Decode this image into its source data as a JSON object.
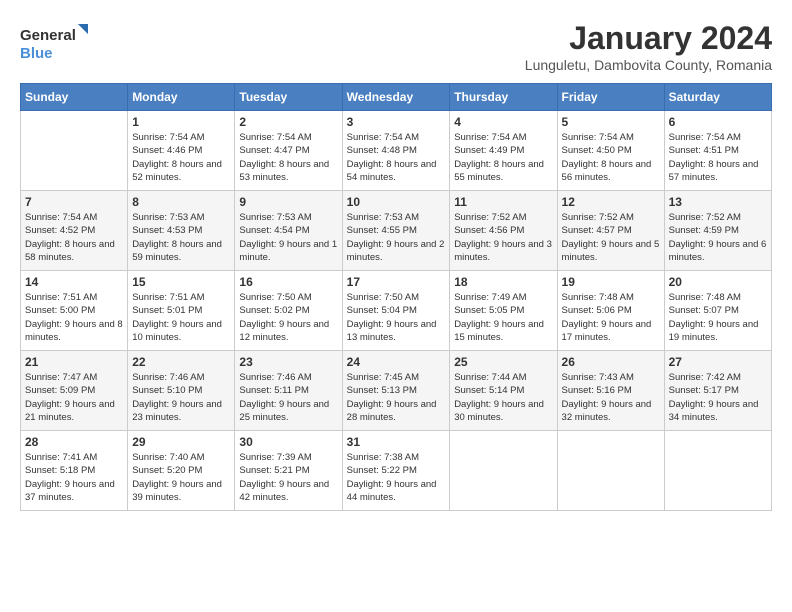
{
  "logo": {
    "line1": "General",
    "line2": "Blue"
  },
  "header": {
    "month_year": "January 2024",
    "location": "Lunguletu, Dambovita County, Romania"
  },
  "weekdays": [
    "Sunday",
    "Monday",
    "Tuesday",
    "Wednesday",
    "Thursday",
    "Friday",
    "Saturday"
  ],
  "weeks": [
    [
      {
        "day": "",
        "sunrise": "",
        "sunset": "",
        "daylight": ""
      },
      {
        "day": "1",
        "sunrise": "Sunrise: 7:54 AM",
        "sunset": "Sunset: 4:46 PM",
        "daylight": "Daylight: 8 hours and 52 minutes."
      },
      {
        "day": "2",
        "sunrise": "Sunrise: 7:54 AM",
        "sunset": "Sunset: 4:47 PM",
        "daylight": "Daylight: 8 hours and 53 minutes."
      },
      {
        "day": "3",
        "sunrise": "Sunrise: 7:54 AM",
        "sunset": "Sunset: 4:48 PM",
        "daylight": "Daylight: 8 hours and 54 minutes."
      },
      {
        "day": "4",
        "sunrise": "Sunrise: 7:54 AM",
        "sunset": "Sunset: 4:49 PM",
        "daylight": "Daylight: 8 hours and 55 minutes."
      },
      {
        "day": "5",
        "sunrise": "Sunrise: 7:54 AM",
        "sunset": "Sunset: 4:50 PM",
        "daylight": "Daylight: 8 hours and 56 minutes."
      },
      {
        "day": "6",
        "sunrise": "Sunrise: 7:54 AM",
        "sunset": "Sunset: 4:51 PM",
        "daylight": "Daylight: 8 hours and 57 minutes."
      }
    ],
    [
      {
        "day": "7",
        "sunrise": "Sunrise: 7:54 AM",
        "sunset": "Sunset: 4:52 PM",
        "daylight": "Daylight: 8 hours and 58 minutes."
      },
      {
        "day": "8",
        "sunrise": "Sunrise: 7:53 AM",
        "sunset": "Sunset: 4:53 PM",
        "daylight": "Daylight: 8 hours and 59 minutes."
      },
      {
        "day": "9",
        "sunrise": "Sunrise: 7:53 AM",
        "sunset": "Sunset: 4:54 PM",
        "daylight": "Daylight: 9 hours and 1 minute."
      },
      {
        "day": "10",
        "sunrise": "Sunrise: 7:53 AM",
        "sunset": "Sunset: 4:55 PM",
        "daylight": "Daylight: 9 hours and 2 minutes."
      },
      {
        "day": "11",
        "sunrise": "Sunrise: 7:52 AM",
        "sunset": "Sunset: 4:56 PM",
        "daylight": "Daylight: 9 hours and 3 minutes."
      },
      {
        "day": "12",
        "sunrise": "Sunrise: 7:52 AM",
        "sunset": "Sunset: 4:57 PM",
        "daylight": "Daylight: 9 hours and 5 minutes."
      },
      {
        "day": "13",
        "sunrise": "Sunrise: 7:52 AM",
        "sunset": "Sunset: 4:59 PM",
        "daylight": "Daylight: 9 hours and 6 minutes."
      }
    ],
    [
      {
        "day": "14",
        "sunrise": "Sunrise: 7:51 AM",
        "sunset": "Sunset: 5:00 PM",
        "daylight": "Daylight: 9 hours and 8 minutes."
      },
      {
        "day": "15",
        "sunrise": "Sunrise: 7:51 AM",
        "sunset": "Sunset: 5:01 PM",
        "daylight": "Daylight: 9 hours and 10 minutes."
      },
      {
        "day": "16",
        "sunrise": "Sunrise: 7:50 AM",
        "sunset": "Sunset: 5:02 PM",
        "daylight": "Daylight: 9 hours and 12 minutes."
      },
      {
        "day": "17",
        "sunrise": "Sunrise: 7:50 AM",
        "sunset": "Sunset: 5:04 PM",
        "daylight": "Daylight: 9 hours and 13 minutes."
      },
      {
        "day": "18",
        "sunrise": "Sunrise: 7:49 AM",
        "sunset": "Sunset: 5:05 PM",
        "daylight": "Daylight: 9 hours and 15 minutes."
      },
      {
        "day": "19",
        "sunrise": "Sunrise: 7:48 AM",
        "sunset": "Sunset: 5:06 PM",
        "daylight": "Daylight: 9 hours and 17 minutes."
      },
      {
        "day": "20",
        "sunrise": "Sunrise: 7:48 AM",
        "sunset": "Sunset: 5:07 PM",
        "daylight": "Daylight: 9 hours and 19 minutes."
      }
    ],
    [
      {
        "day": "21",
        "sunrise": "Sunrise: 7:47 AM",
        "sunset": "Sunset: 5:09 PM",
        "daylight": "Daylight: 9 hours and 21 minutes."
      },
      {
        "day": "22",
        "sunrise": "Sunrise: 7:46 AM",
        "sunset": "Sunset: 5:10 PM",
        "daylight": "Daylight: 9 hours and 23 minutes."
      },
      {
        "day": "23",
        "sunrise": "Sunrise: 7:46 AM",
        "sunset": "Sunset: 5:11 PM",
        "daylight": "Daylight: 9 hours and 25 minutes."
      },
      {
        "day": "24",
        "sunrise": "Sunrise: 7:45 AM",
        "sunset": "Sunset: 5:13 PM",
        "daylight": "Daylight: 9 hours and 28 minutes."
      },
      {
        "day": "25",
        "sunrise": "Sunrise: 7:44 AM",
        "sunset": "Sunset: 5:14 PM",
        "daylight": "Daylight: 9 hours and 30 minutes."
      },
      {
        "day": "26",
        "sunrise": "Sunrise: 7:43 AM",
        "sunset": "Sunset: 5:16 PM",
        "daylight": "Daylight: 9 hours and 32 minutes."
      },
      {
        "day": "27",
        "sunrise": "Sunrise: 7:42 AM",
        "sunset": "Sunset: 5:17 PM",
        "daylight": "Daylight: 9 hours and 34 minutes."
      }
    ],
    [
      {
        "day": "28",
        "sunrise": "Sunrise: 7:41 AM",
        "sunset": "Sunset: 5:18 PM",
        "daylight": "Daylight: 9 hours and 37 minutes."
      },
      {
        "day": "29",
        "sunrise": "Sunrise: 7:40 AM",
        "sunset": "Sunset: 5:20 PM",
        "daylight": "Daylight: 9 hours and 39 minutes."
      },
      {
        "day": "30",
        "sunrise": "Sunrise: 7:39 AM",
        "sunset": "Sunset: 5:21 PM",
        "daylight": "Daylight: 9 hours and 42 minutes."
      },
      {
        "day": "31",
        "sunrise": "Sunrise: 7:38 AM",
        "sunset": "Sunset: 5:22 PM",
        "daylight": "Daylight: 9 hours and 44 minutes."
      },
      {
        "day": "",
        "sunrise": "",
        "sunset": "",
        "daylight": ""
      },
      {
        "day": "",
        "sunrise": "",
        "sunset": "",
        "daylight": ""
      },
      {
        "day": "",
        "sunrise": "",
        "sunset": "",
        "daylight": ""
      }
    ]
  ]
}
